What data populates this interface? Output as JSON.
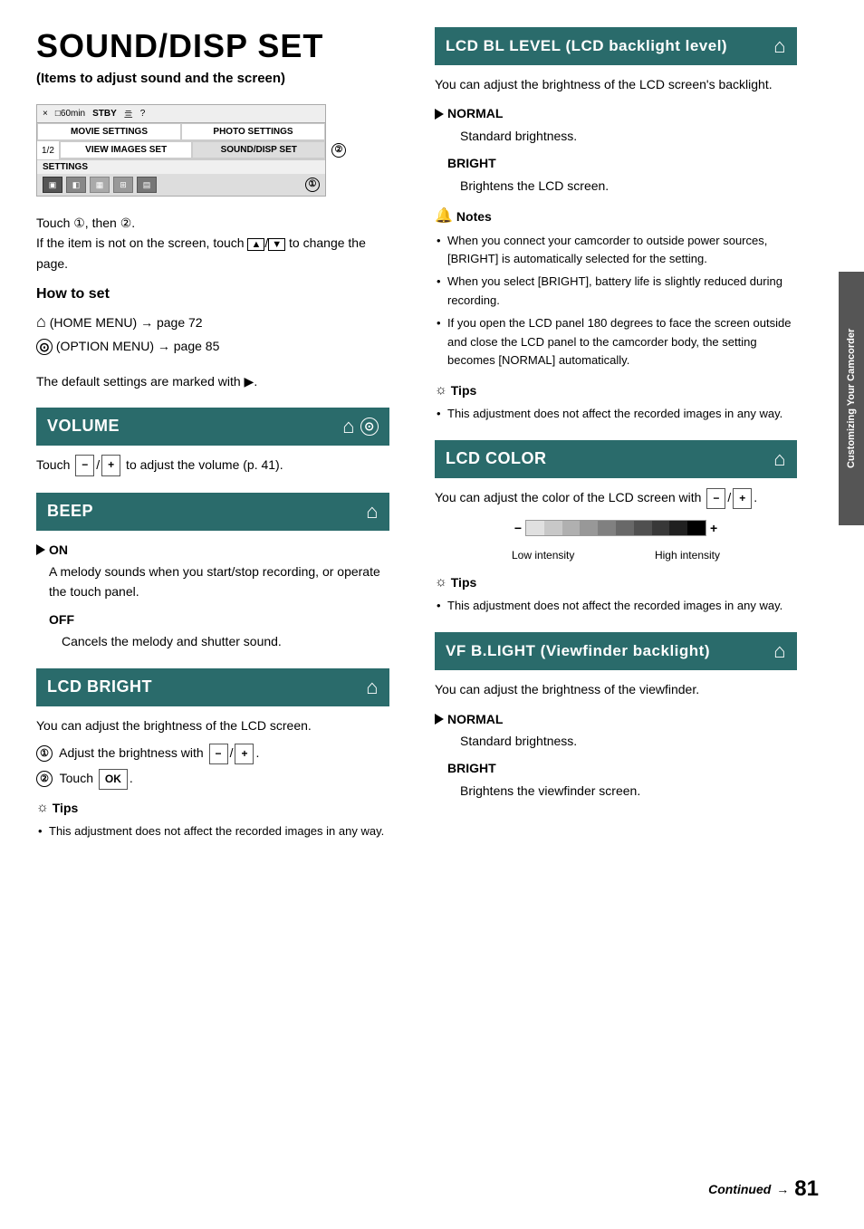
{
  "page": {
    "title": "SOUND/DISP SET",
    "subtitle": "(Items to adjust sound and the screen)"
  },
  "camera_ui": {
    "top_bar": [
      "×",
      "□60min",
      "STBY",
      "亖",
      "?"
    ],
    "row1": [
      "MOVIE SETTINGS",
      "PHOTO SETTINGS"
    ],
    "page_num": "1/2",
    "row2": [
      "VIEW IMAGES SET",
      "SOUND/DISP SET"
    ],
    "settings_label": "SETTINGS",
    "circle2": "②",
    "circle1": "①"
  },
  "touch_instructions": {
    "line1": "Touch ①, then ②.",
    "line2": "If the item is not on the screen, touch   /",
    "line3": "  to change the page."
  },
  "how_to_set": {
    "heading": "How to set",
    "home_menu": "(HOME MENU) → page 72",
    "option_menu": "(OPTION MENU) → page 85"
  },
  "default_note": "The default settings are marked with ▶.",
  "volume": {
    "header": "VOLUME",
    "body": "Touch  −  /  +  to adjust the volume (p. 41)."
  },
  "beep": {
    "header": "BEEP",
    "on_label": "▶ON",
    "on_desc": "A melody sounds when you start/stop recording, or operate the touch panel.",
    "off_label": "OFF",
    "off_desc": "Cancels the melody and shutter sound."
  },
  "lcd_bright": {
    "header": "LCD BRIGHT",
    "intro": "You can adjust the brightness of the LCD screen.",
    "step1": "① Adjust the brightness with  −  /  +  .",
    "step2": "② Touch  OK .",
    "tips_heading": "Tips",
    "tip1": "This adjustment does not affect the recorded images in any way."
  },
  "lcd_bl_level": {
    "header": "LCD BL LEVEL (LCD backlight level)",
    "intro": "You can adjust the brightness of the LCD screen's backlight.",
    "normal_label": "▶NORMAL",
    "normal_desc": "Standard brightness.",
    "bright_label": "BRIGHT",
    "bright_desc": "Brightens the LCD screen.",
    "notes_heading": "Notes",
    "note1": "When you connect your camcorder to outside power sources, [BRIGHT] is automatically selected for the setting.",
    "note2": "When you select [BRIGHT], battery life is slightly reduced during recording.",
    "note3": "If you open the LCD panel 180 degrees to face the screen outside and close the LCD panel to the camcorder body, the setting becomes [NORMAL] automatically.",
    "tips_heading": "Tips",
    "tip1": "This adjustment does not affect the recorded images in any way."
  },
  "lcd_color": {
    "header": "LCD COLOR",
    "intro": "You can adjust the color of the LCD screen with  −  /  +  .",
    "bar_minus": "−",
    "bar_plus": "+",
    "label_low": "Low intensity",
    "label_high": "High intensity",
    "tips_heading": "Tips",
    "tip1": "This adjustment does not affect the recorded images in any way."
  },
  "vf_blight": {
    "header": "VF B.LIGHT (Viewfinder backlight)",
    "intro": "You can adjust the brightness of the viewfinder.",
    "normal_label": "▶NORMAL",
    "normal_desc": "Standard brightness.",
    "bright_label": "BRIGHT",
    "bright_desc": "Brightens the viewfinder screen."
  },
  "side_tab": "Customizing Your Camcorder",
  "footer": {
    "continued": "Continued",
    "arrow": "→",
    "page_number": "81"
  }
}
